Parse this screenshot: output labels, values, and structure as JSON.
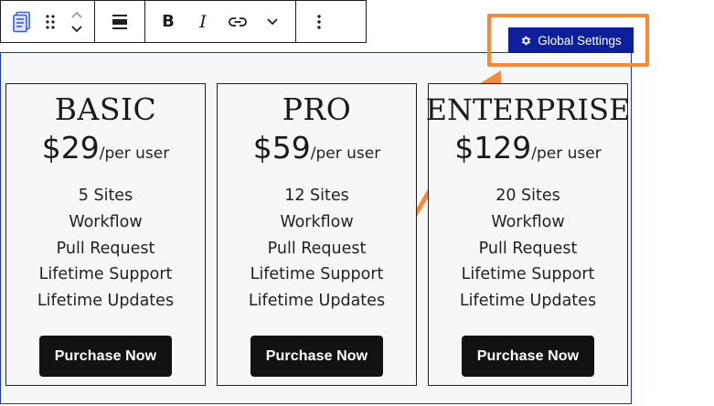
{
  "toolbar": {
    "block_icon": "document-block-icon",
    "drag_icon": "drag-handle-icon",
    "move_up_icon": "chevron-up-icon",
    "move_down_icon": "chevron-down-icon",
    "align_icon": "align-icon",
    "bold_label": "B",
    "italic_label": "I",
    "link_icon": "link-icon",
    "more_formats_icon": "chevron-down-icon",
    "options_icon": "more-vertical-icon"
  },
  "global_settings": {
    "label": "Global Settings",
    "icon": "gear-icon"
  },
  "annotation": {
    "highlight_color": "#f58a3c"
  },
  "plans": [
    {
      "title": "BASIC",
      "price": "$29",
      "period": "/per user",
      "features": [
        "5 Sites",
        "Workflow",
        "Pull Request",
        "Lifetime Support",
        "Lifetime Updates"
      ],
      "button": "Purchase Now"
    },
    {
      "title": "PRO",
      "price": "$59",
      "period": "/per user",
      "features": [
        "12 Sites",
        "Workflow",
        "Pull Request",
        "Lifetime Support",
        "Lifetime Updates"
      ],
      "button": "Purchase Now"
    },
    {
      "title": "ENTERPRISE",
      "price": "$129",
      "period": "/per user",
      "features": [
        "20 Sites",
        "Workflow",
        "Pull Request",
        "Lifetime Support",
        "Lifetime Updates"
      ],
      "button": "Purchase Now"
    }
  ],
  "colors": {
    "accent": "#0d1f9a",
    "selection": "#1e3a9e",
    "button": "#121212"
  }
}
